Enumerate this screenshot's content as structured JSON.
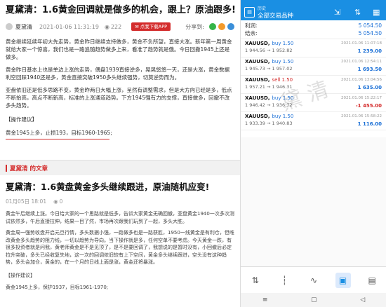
{
  "article1": {
    "title": "夏黛清：1.6黄金回调就是做多的机会，跟上？原油跟多!",
    "author": "夏黛清",
    "time": "2021-01-06 11:31:19",
    "views": "222",
    "download_label": "✉ 点我下载APP",
    "share_label": "分享到:",
    "paragraphs": [
      "黄金继续延续年初大先走势，黄金昨日继续支持做多，黄金不负所望，直接大涨。新年第一周黄金就给大家一个惊喜，我们也是一路追随趋势做多上来，看准了趋势就是俄。今日回撤1945上还是做多。",
      "黄金昨日基本上也是单边上涨的走势，偶盘1939直接逆多，晃晃悠悠一天，还是大涨，黄金数据利空回踩1940还是多，黄金直接突破1950多头继续强势，切莫逆势而为。",
      "亚盘依旧还是低多思路不变，黄金昨两日大幅上涨，呈然有调整需求，但是大方向已经是多，低点不断抬高，高点不断新高，标准的上涨通道趋势。下方1945强有力的支撑，直接做多，回撤不改多头趋势。"
    ],
    "tag_label": "【操作建议】",
    "advice": "黄金1945上多，止损193，目标1960-1965;"
  },
  "band_label": "夏黛清 的文章",
  "article2": {
    "title": "夏黛清：1.6黄盘黄金多头继续跟进，原油随机应变!",
    "date": "01月05日 18:01",
    "views": "0",
    "paragraphs": [
      "黄金午后继续上涨。今日给大家的一个思路就是低多，告诉大家黄金无确回撤，亚盘黄金1940一次多次测试依然多，午后直接拉伸，结果一目了然，市场再次跟我们玩到了一起，多头大胜。",
      "黄金周一强势收盘开启元旦行情，多头数据小强，一路做多也是一路获胜，1950一线黄金是有利仓，但唯改黄金多头趋势的阻力线，一切以趋势为导向。当下操作就是多，任何空单不要考虑。今天黄金一跌，有很多投资者就是问我，黄老师黄金是不是见顶了，是不是要回调了，我想说的是暂时没有，小回撤后必定拉升突破，多头已经收复失地，这一次的回调依旧较有上下空间，黄金多头继续跟进，空头没有这种趋势，多头会加仓，黄金的，在一个月的日线上面是涨，黄金还将暴涨。"
    ],
    "tag_label": "【操作建议】",
    "advice": "黄金1945上多，保护1937，目标1961-1970;"
  },
  "mt4": {
    "header_sub": "历史",
    "header_title": "全部交易品种",
    "summary": [
      {
        "label": "利润:",
        "value": "5 054.50"
      },
      {
        "label": "结余:",
        "value": "5 054.50"
      }
    ],
    "trades": [
      {
        "symbol": "XAUUSD,",
        "action": "buy 1.50",
        "side": "buy",
        "prices": "1 944.56 → 1 952.82",
        "datetime": "2021.01.06 11:07:18",
        "profit": "1 239.00",
        "profit_sign": "pos"
      },
      {
        "symbol": "XAUUSD,",
        "action": "buy 1.50",
        "side": "buy",
        "prices": "1 945.73 → 1 957.02",
        "datetime": "2021.01.06 12:54:11",
        "profit": "1 693.50",
        "profit_sign": "pos"
      },
      {
        "symbol": "XAUUSD,",
        "action": "sell 1.50",
        "side": "sell",
        "prices": "1 957.21 → 1 946.31",
        "datetime": "2021.01.06 13:04:56",
        "profit": "1 635.00",
        "profit_sign": "pos"
      },
      {
        "symbol": "XAUUSD,",
        "action": "buy 1.50",
        "side": "buy",
        "prices": "1 946.42 → 1 936.72",
        "datetime": "2021.01.06 15:22:17",
        "profit": "-1 455.00",
        "profit_sign": "neg"
      },
      {
        "symbol": "XAUUSD,",
        "action": "buy 1.50",
        "side": "buy",
        "prices": "1 933.39 → 1 940.83",
        "datetime": "2021.01.06 15:58:22",
        "profit": "1 116.00",
        "profit_sign": "pos"
      }
    ],
    "watermark": "黛 清"
  },
  "colors": {
    "accent_blue": "#1a8fe3",
    "accent_red": "#d42b2b"
  },
  "icons": [
    "history-icon",
    "add-symbol-icon",
    "sort-icon",
    "calendar-icon",
    "quotes-icon",
    "chart-icon",
    "trade-icon",
    "history-nav-icon",
    "settings-icon"
  ]
}
